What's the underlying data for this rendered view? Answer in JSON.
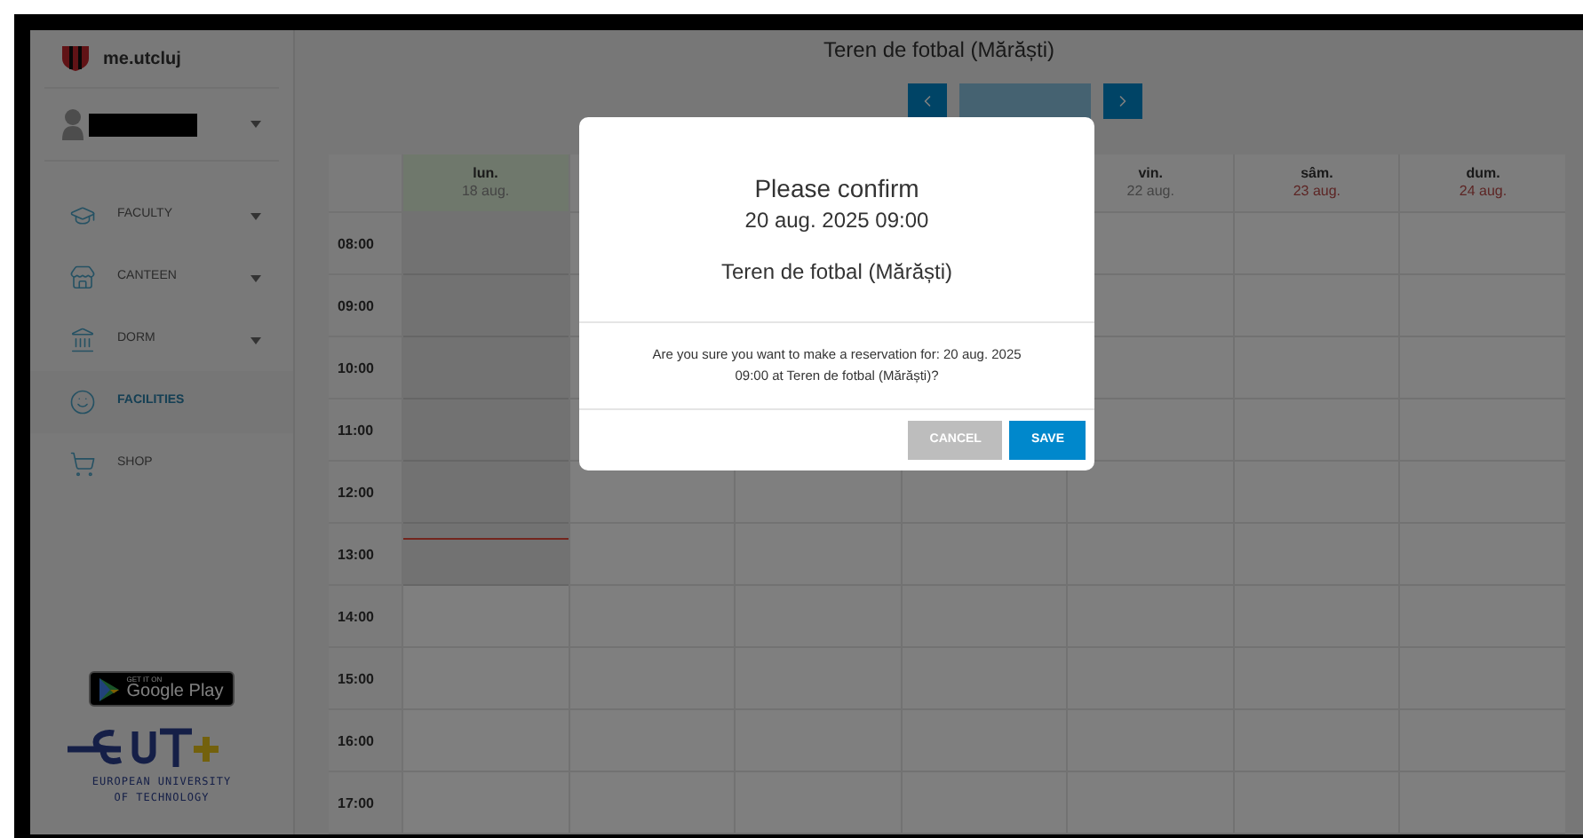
{
  "sidebar": {
    "brand": "me.utcluj",
    "user_menu": {
      "expanded": false
    },
    "menu": [
      {
        "label": "FACULTY",
        "has_submenu": true,
        "selected": false
      },
      {
        "label": "CANTEEN",
        "has_submenu": true,
        "selected": false
      },
      {
        "label": "DORM",
        "has_submenu": true,
        "selected": false
      },
      {
        "label": "FACILITIES",
        "has_submenu": false,
        "selected": true
      },
      {
        "label": "SHOP",
        "has_submenu": false,
        "selected": false
      }
    ],
    "store_badge": {
      "small": "GET IT ON",
      "big": "Google Play"
    },
    "partner": {
      "line1": "EUROPEAN UNIVERSITY",
      "line2": "OF TECHNOLOGY"
    }
  },
  "main": {
    "title": "Teren de fotbal (Mărăști)",
    "calendar": {
      "days": [
        {
          "name": "lun.",
          "date": "18 aug.",
          "today": true,
          "weekend": false
        },
        {
          "name": "vin.",
          "date": "22 aug.",
          "today": false,
          "weekend": false
        },
        {
          "name": "sâm.",
          "date": "23 aug.",
          "today": false,
          "weekend": true
        },
        {
          "name": "dum.",
          "date": "24 aug.",
          "today": false,
          "weekend": true
        }
      ],
      "times": [
        "08:00",
        "09:00",
        "10:00",
        "11:00",
        "12:00",
        "13:00",
        "14:00",
        "15:00",
        "16:00",
        "17:00"
      ]
    }
  },
  "dialog": {
    "title": "Please confirm",
    "datetime": "20 aug. 2025 09:00",
    "facility": "Teren de fotbal (Mărăști)",
    "message": "Are you sure you want to make a reservation for: 20 aug. 2025 09:00 at Teren de fotbal (Mărăști)?",
    "buttons": [
      {
        "label": "CANCEL",
        "kind": "secondary"
      },
      {
        "label": "SAVE",
        "kind": "primary"
      }
    ]
  }
}
